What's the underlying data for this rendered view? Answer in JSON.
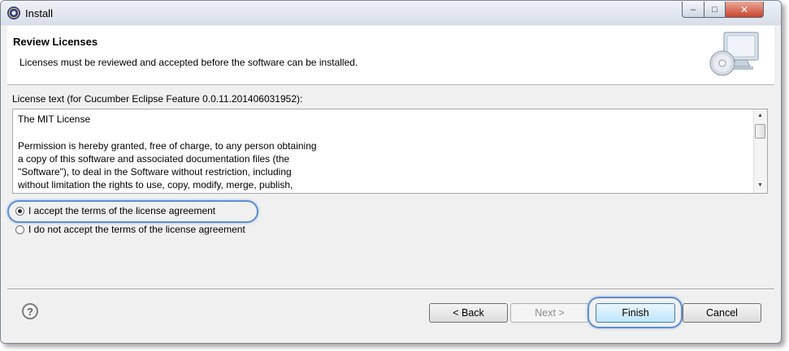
{
  "window": {
    "title": "Install",
    "app_icon": "eclipse-icon"
  },
  "title_controls": {
    "minimize_icon": "minimize-icon",
    "maximize_icon": "maximize-icon",
    "close_icon": "close-icon"
  },
  "header": {
    "title": "Review Licenses",
    "subtitle": "Licenses must be reviewed and accepted before the software can be installed.",
    "graphic_icon": "install-monitor-cd-icon"
  },
  "license": {
    "label": "License text (for Cucumber Eclipse Feature 0.0.11.201406031952):",
    "text": "The MIT License\n\nPermission is hereby granted, free of charge, to any person obtaining\na copy of this software and associated documentation files (the\n\"Software\"), to deal in the Software without restriction, including\nwithout limitation the rights to use, copy, modify, merge, publish,"
  },
  "options": [
    {
      "label": "I accept the terms of the license agreement",
      "selected": true
    },
    {
      "label": "I do not accept the terms of the license agreement",
      "selected": false
    }
  ],
  "buttons": {
    "back": "< Back",
    "next": "Next >",
    "finish": "Finish",
    "cancel": "Cancel"
  },
  "help_icon": "help-icon",
  "colors": {
    "highlight": "#5d8fd1",
    "header_bg": "#ffffff",
    "dialog_bg": "#f0f0f0"
  }
}
